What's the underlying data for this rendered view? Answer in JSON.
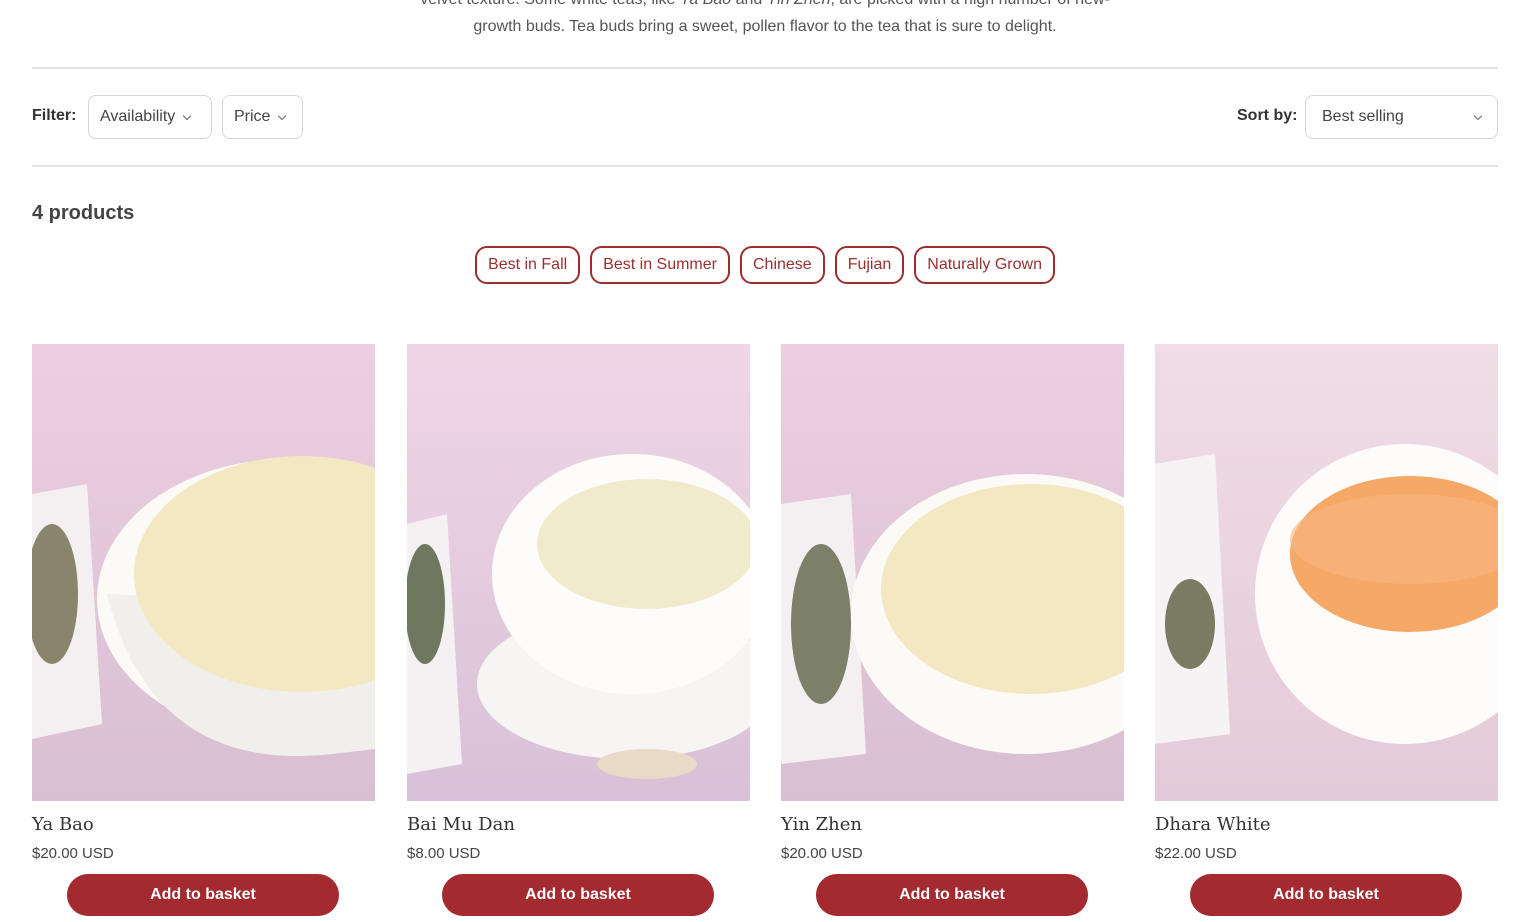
{
  "intro": {
    "line1_a": "velvet texture. Some white teas, like ",
    "line1_em1": "Ya Bao",
    "line1_b": " and ",
    "line1_em2": "Yin Zhen",
    "line1_c": ", are picked with a high number of new-",
    "line2": "growth buds. Tea buds bring a sweet, pollen flavor to the tea that is sure to delight."
  },
  "filters": {
    "label": "Filter:",
    "availability": "Availability",
    "price": "Price"
  },
  "sort": {
    "label": "Sort by:",
    "selected": "Best selling"
  },
  "product_count": "4 products",
  "tags": [
    "Best in Fall",
    "Best in Summer",
    "Chinese",
    "Fujian",
    "Naturally Grown"
  ],
  "products": [
    {
      "name": "Ya Bao",
      "price": "$20.00 USD",
      "button": "Add to basket"
    },
    {
      "name": "Bai Mu Dan",
      "price": "$8.00 USD",
      "button": "Add to basket"
    },
    {
      "name": "Yin Zhen",
      "price": "$20.00 USD",
      "button": "Add to basket"
    },
    {
      "name": "Dhara White",
      "price": "$22.00 USD",
      "button": "Add to basket"
    }
  ],
  "colors": {
    "accent": "#a32a2f",
    "tag_border": "#9b2f2f",
    "background_photo": "#e9d3df",
    "tea_pale": "#f3e9c4",
    "tea_amber": "#f6a866"
  }
}
